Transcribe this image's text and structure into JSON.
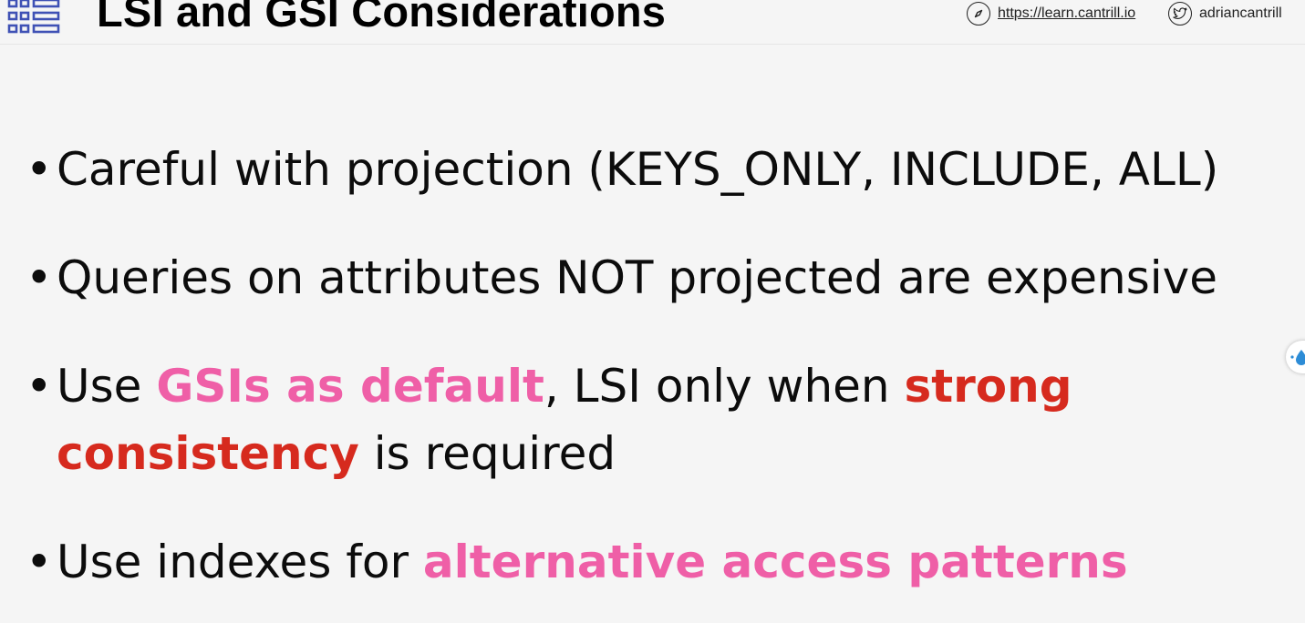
{
  "header": {
    "title": "LSI and GSI Considerations",
    "site_link": "https://learn.cantrill.io",
    "twitter_handle": "adriancantrill"
  },
  "bullets": [
    {
      "segments": [
        {
          "text": "Careful with projection (KEYS_ONLY, INCLUDE, ALL)",
          "style": "normal"
        }
      ]
    },
    {
      "segments": [
        {
          "text": "Queries on attributes NOT projected are expensive",
          "style": "normal"
        }
      ]
    },
    {
      "segments": [
        {
          "text": "Use ",
          "style": "normal"
        },
        {
          "text": "GSIs as default",
          "style": "pink"
        },
        {
          "text": ", LSI only when ",
          "style": "normal"
        },
        {
          "text": "strong",
          "style": "red"
        }
      ],
      "continuation": [
        {
          "text": "consistency",
          "style": "red"
        },
        {
          "text": " is required",
          "style": "normal"
        }
      ]
    },
    {
      "segments": [
        {
          "text": "Use indexes for ",
          "style": "normal"
        },
        {
          "text": "alternative access patterns",
          "style": "pink"
        }
      ]
    }
  ],
  "colors": {
    "background": "#f5f5f5",
    "pink_emphasis": "#ef5fa7",
    "red_emphasis": "#d62a1e",
    "logo_blue": "#3f51b5"
  },
  "icons": {
    "logo": "table-grid-icon",
    "site": "compass-icon",
    "twitter": "twitter-bird-icon",
    "side_widget": "droplet-icon"
  }
}
